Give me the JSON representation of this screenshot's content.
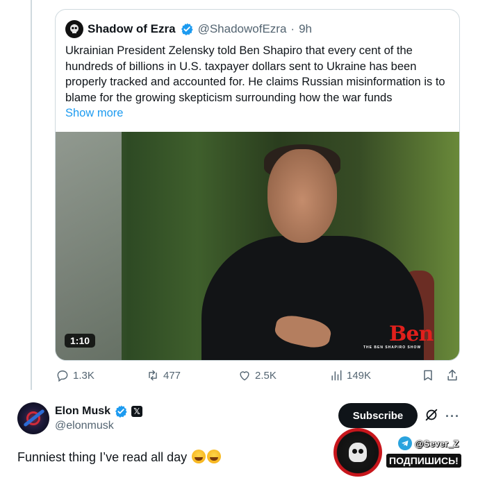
{
  "quoted_tweet": {
    "author_name": "Shadow of Ezra",
    "handle": "@ShadowofEzra",
    "separator": "·",
    "time": "9h",
    "text": "Ukrainian President Zelensky told Ben Shapiro that every cent of the hundreds of billions in U.S. taxpayer dollars sent to Ukraine has been properly tracked and accounted for. He claims Russian misinformation is to blame for the growing skepticism surrounding how the war funds",
    "show_more": "Show more",
    "video": {
      "duration": "1:10",
      "overlay_logo": "Ben",
      "overlay_sub": "THE BEN SHAPIRO SHOW"
    }
  },
  "actions": {
    "replies": "1.3K",
    "reposts": "477",
    "likes": "2.5K",
    "views": "149K"
  },
  "reply": {
    "author_name": "Elon Musk",
    "handle": "@elonmusk",
    "affiliate_badge": "𝕏",
    "text": "Funniest thing I’ve read all day",
    "subscribe_label": "Subscribe",
    "more_label": "···"
  },
  "watermark": {
    "telegram_handle": "@Sever_Z",
    "cta": "ПОДПИШИСЬ!"
  },
  "colors": {
    "accent": "#1d9bf0",
    "secondary_text": "#536471",
    "border": "#cfd9de",
    "primary_text": "#0f1419"
  }
}
